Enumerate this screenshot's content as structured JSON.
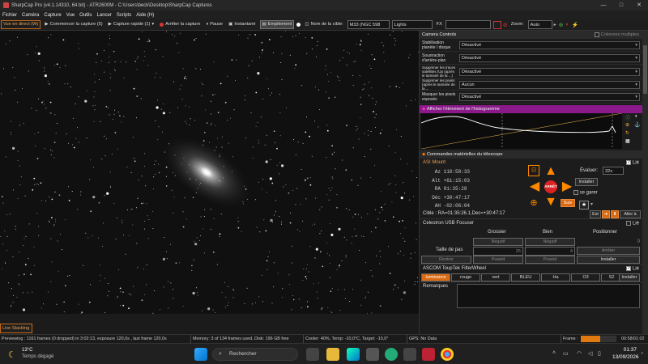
{
  "window": {
    "title": "SharpCap Pro (v4.1.14310, 64 bit) - ATR2600M - C:\\Users\\beck\\Desktop\\SharpCap Captures"
  },
  "menu": [
    "Fichier",
    "Caméra",
    "Capture",
    "Vue",
    "Outils",
    "Lancer",
    "Scripts",
    "Aide (H)"
  ],
  "toolbar": {
    "live_view": "Vue en direct (W)",
    "start_capture": "Commencer la capture (5)",
    "quick_capture": "Capture rapide (1)",
    "stop_capture": "Arrêter la capture",
    "pause": "Pause",
    "snapshot": "Instantané",
    "stacking": "Empilement",
    "target_label": "Nom de la cible:",
    "target_value": "M33 (NGC 598",
    "lights_value": "Lights",
    "fx_label": "FX",
    "zoom_label": "Zoom:",
    "zoom_value": "Auto"
  },
  "panel": {
    "camera_controls": "Camera Controls",
    "multi_columns": "Colonnes multiples",
    "controls": [
      {
        "label": "Stabilisation planète / disque",
        "value": "Désactivé"
      },
      {
        "label": "Soustraction d'arrière-plan",
        "value": "Désactivé"
      },
      {
        "label": "Supprimer les traces satellites (Up (après le tamisée de la ...)",
        "value": "Désactivé"
      },
      {
        "label": "Supprimer les pixels (après le tamisée de la ...",
        "value": "Aucun"
      },
      {
        "label": "Masquer les pixels exposés",
        "value": "Désactivé"
      }
    ],
    "histogram_title": "Afficher l'étirement de l'histogramme",
    "telescope_title": "Commandes matérielles du télescope",
    "mount": {
      "name": "ASI Mount",
      "connected_label": "Lié",
      "coords": [
        {
          "k": "Az",
          "v": "110:58:33"
        },
        {
          "k": "Alt",
          "v": "+61:15:03"
        },
        {
          "k": "RA",
          "v": "01:35:28"
        },
        {
          "k": "Déc",
          "v": "+30:47:17"
        },
        {
          "k": "AH",
          "v": "-02:06:04"
        }
      ],
      "speed_label": "Évaluer:",
      "speed_value": "32x",
      "setup": "Installer",
      "park_label": "se garer",
      "stop": "ARRÊT",
      "follow": "Suiv",
      "target": "Cible : RA=01:35:26.1,Dec=+30:47:17",
      "east": "Est",
      "west": "Aller à"
    },
    "focuser": {
      "name": "Celestron USB Focuser",
      "connected_label": "Lié",
      "col_coarse": "Grossier",
      "col_fine": "Bien",
      "col_position": "Positionner",
      "neg1": "Négatif",
      "neg2": "Négatif",
      "position_value": "0",
      "step_label": "Taille de pas",
      "step_coarse": "25",
      "step_fine": "4",
      "stop": "Arrêter",
      "retract": "Rentrer",
      "push1": "Poseid",
      "push2": "Poseid",
      "setup": "Installer"
    },
    "filterwheel": {
      "name": "ASCOM ToupTek FilterWheel",
      "connected_label": "Lié",
      "filters": [
        "luminance",
        "rouge",
        "vert",
        "BLEU",
        "Ha",
        "O3",
        "S2"
      ],
      "setup": "Installer"
    },
    "remarks_label": "Remarques"
  },
  "live_stacking": "Live Stacking",
  "status": {
    "previewing": "Previewing : 1161 frames (0 dropped) in 3:02:13, exposure 120,0s , last frame 120,0s",
    "memory": "Memory: 3 of 134 frames used, Disk: 196 GB free",
    "cooler": "Cooler: 40%, Temp: -10,0°C, Target: -10,0°",
    "gps": "GPS: No Data",
    "frame_label": "Frame :",
    "frame_time": "00:58/01:02",
    "frame_progress": 0.55
  },
  "taskbar": {
    "temp": "13°C",
    "weather": "Temps dégagé",
    "search": "Rechercher",
    "time": "01:37",
    "date": "13/09/2026"
  },
  "colors": {
    "accent": "#d96a12",
    "histogram_header": "#8a1a8a"
  }
}
